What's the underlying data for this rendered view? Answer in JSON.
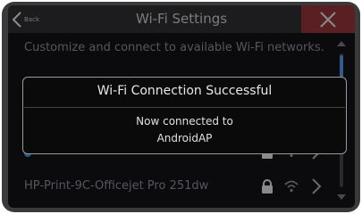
{
  "header": {
    "back_label": "Back",
    "title": "Wi-Fi Settings"
  },
  "intro": "Customize and connect to available Wi-Fi networks.",
  "networks": [
    {
      "name": "AndroidAP",
      "connected": true
    },
    {
      "name": "HP-Print-9C-Officejet Pro 251dw",
      "connected": false
    }
  ],
  "dialog": {
    "title": "Wi-Fi Connection Successful",
    "line1": "Now connected to",
    "line2": "AndroidAP"
  },
  "colors": {
    "accent": "#355a8a",
    "close_bg": "#5a1f23"
  }
}
